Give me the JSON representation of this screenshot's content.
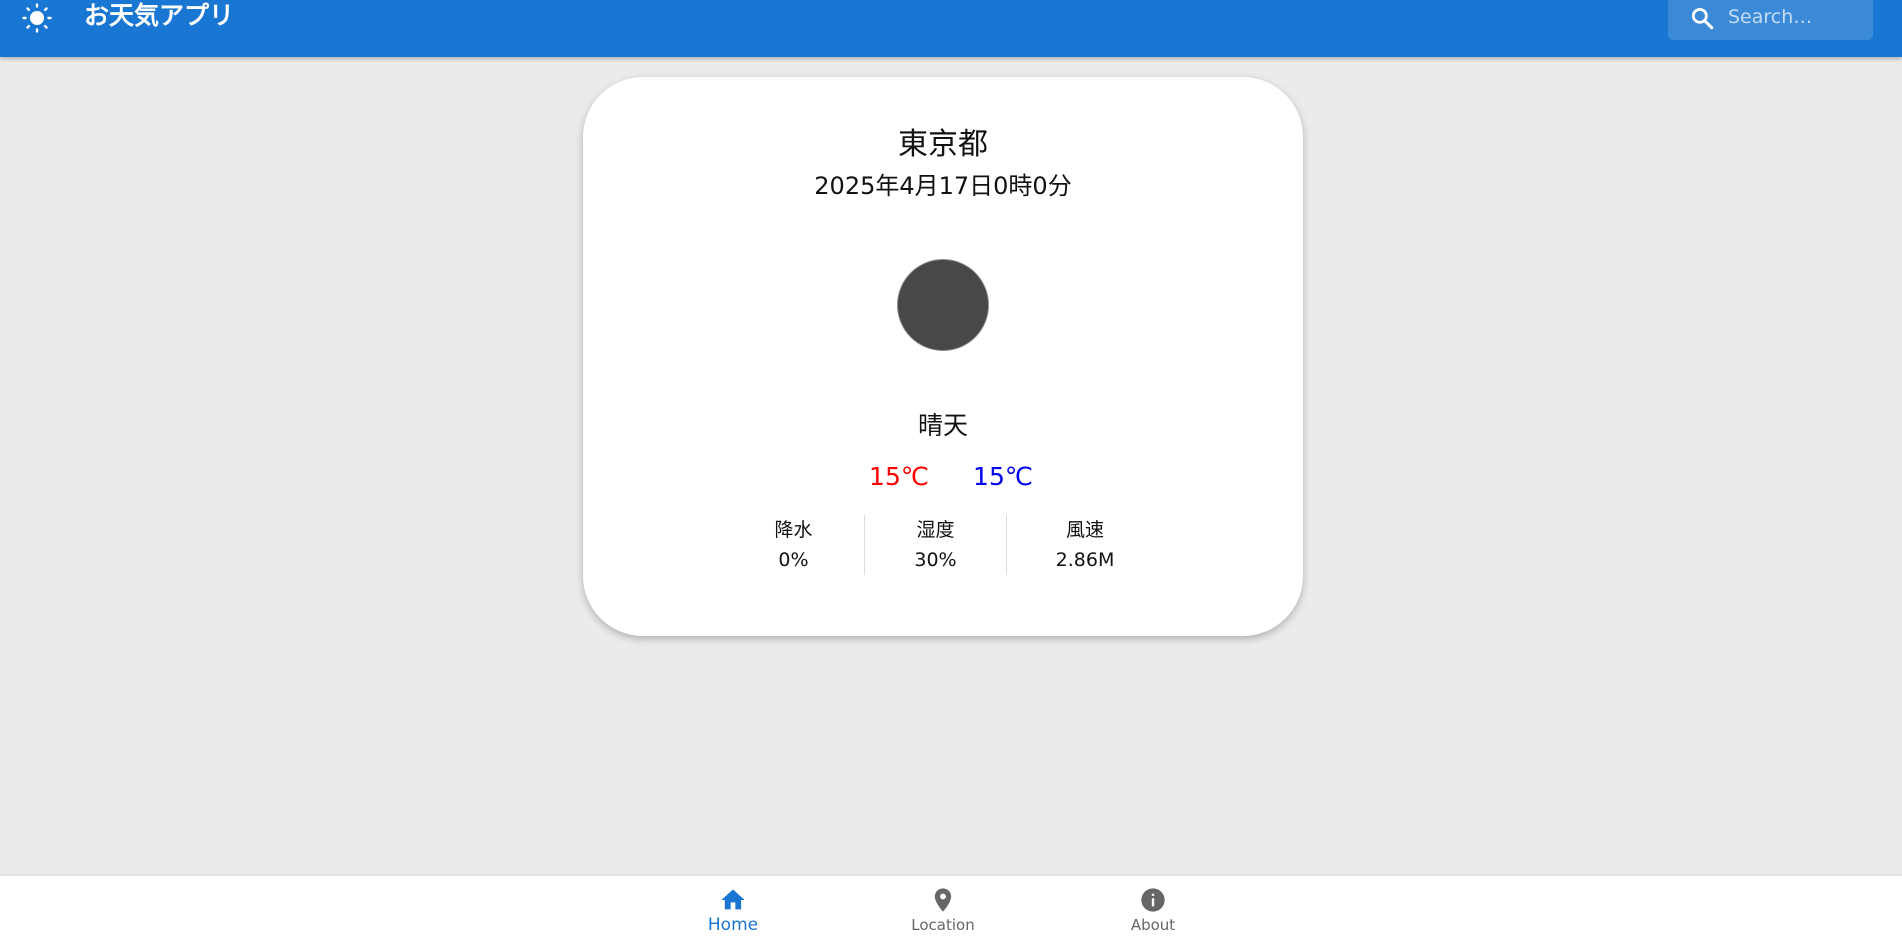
{
  "app": {
    "title": "お天気アプリ",
    "search_placeholder": "Search…",
    "accent_color": "#1976d2"
  },
  "weather": {
    "city": "東京都",
    "datetime": "2025年4月17日0時0分",
    "condition": "晴天",
    "temp_high": "15℃",
    "temp_low": "15℃",
    "temp_high_color": "#ff0000",
    "temp_low_color": "#0000ee",
    "stats": [
      {
        "label": "降水",
        "value": "0%"
      },
      {
        "label": "湿度",
        "value": "30%"
      },
      {
        "label": "風速",
        "value": "2.86M"
      }
    ]
  },
  "nav": {
    "items": [
      {
        "label": "Home",
        "icon": "home-icon",
        "active": true
      },
      {
        "label": "Location",
        "icon": "location-pin-icon",
        "active": false
      },
      {
        "label": "About",
        "icon": "info-icon",
        "active": false
      }
    ]
  }
}
